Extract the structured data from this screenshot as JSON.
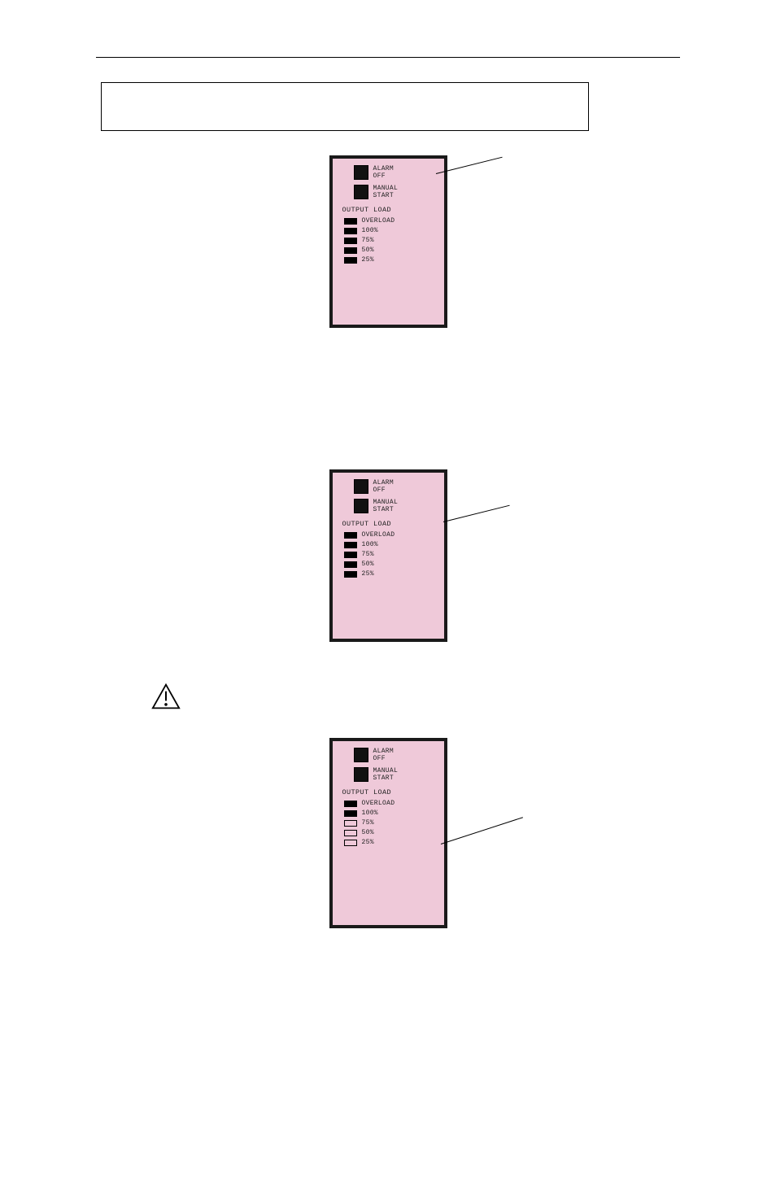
{
  "panel": {
    "alarm_line1": "ALARM",
    "alarm_line2": "OFF",
    "manual_line1": "MANUAL",
    "manual_line2": "START",
    "group": "OUTPUT  LOAD",
    "rows": {
      "overload": "OVERLOAD",
      "p100": "100%",
      "p75": "75%",
      "p50": "50%",
      "p25": "25%"
    }
  }
}
